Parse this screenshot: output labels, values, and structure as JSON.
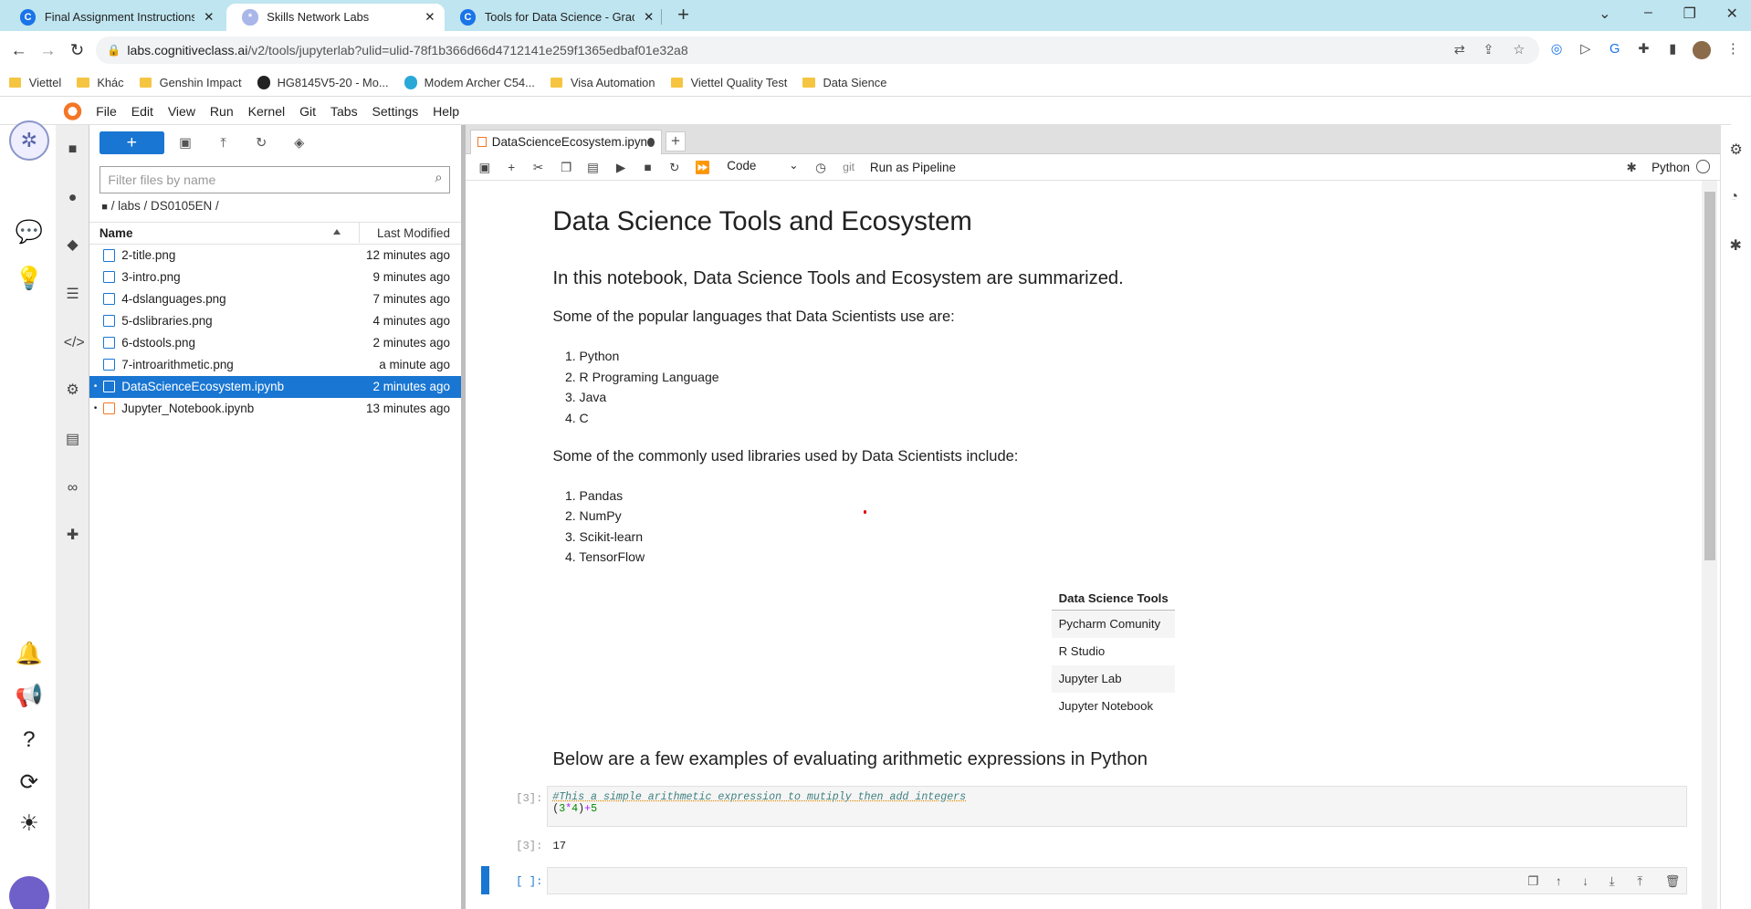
{
  "browser": {
    "tabs": [
      {
        "title": "Final Assignment Instructions: Cr",
        "favicon": "C",
        "favicon_color": "#1a73e8",
        "active": false
      },
      {
        "title": "Skills Network Labs",
        "favicon": "*",
        "favicon_color": "#a9b6e8",
        "active": true
      },
      {
        "title": "Tools for Data Science - Grades |",
        "favicon": "C",
        "favicon_color": "#1a73e8",
        "active": false
      }
    ],
    "new_tab": "+",
    "url_host": "labs.cognitiveclass.ai",
    "url_path": "/v2/tools/jupyterlab?ulid=ulid-78f1b366d66d4712141e259f1365edbaf01e32a8",
    "bookmarks": [
      "Viettel",
      "Khác",
      "Genshin Impact",
      "HG8145V5-20 - Mo...",
      "Modem Archer C54...",
      "Visa Automation",
      "Viettel Quality Test",
      "Data Sience"
    ]
  },
  "menu": [
    "File",
    "Edit",
    "View",
    "Run",
    "Kernel",
    "Git",
    "Tabs",
    "Settings",
    "Help"
  ],
  "file_browser": {
    "new_label": "+",
    "filter_placeholder": "Filter files by name",
    "breadcrumb": "/ labs / DS0105EN /",
    "col_name": "Name",
    "col_modified": "Last Modified",
    "files": [
      {
        "name": "2-title.png",
        "modified": "12 minutes ago",
        "kind": "image",
        "running": false,
        "selected": false
      },
      {
        "name": "3-intro.png",
        "modified": "9 minutes ago",
        "kind": "image",
        "running": false,
        "selected": false
      },
      {
        "name": "4-dslanguages.png",
        "modified": "7 minutes ago",
        "kind": "image",
        "running": false,
        "selected": false
      },
      {
        "name": "5-dslibraries.png",
        "modified": "4 minutes ago",
        "kind": "image",
        "running": false,
        "selected": false
      },
      {
        "name": "6-dstools.png",
        "modified": "2 minutes ago",
        "kind": "image",
        "running": false,
        "selected": false
      },
      {
        "name": "7-introarithmetic.png",
        "modified": "a minute ago",
        "kind": "image",
        "running": false,
        "selected": false
      },
      {
        "name": "DataScienceEcosystem.ipynb",
        "modified": "2 minutes ago",
        "kind": "notebook",
        "running": true,
        "selected": true
      },
      {
        "name": "Jupyter_Notebook.ipynb",
        "modified": "13 minutes ago",
        "kind": "notebook",
        "running": true,
        "selected": false
      }
    ]
  },
  "notebook": {
    "tab_title": "DataScienceEcosystem.ipyn",
    "cell_type": "Code",
    "git_label": "git",
    "run_pipeline": "Run as Pipeline",
    "kernel": "Python",
    "h1": "Data Science Tools and Ecosystem",
    "h2": "In this notebook, Data Science Tools and Ecosystem are summarized.",
    "languages_intro": "Some of the popular languages that Data Scientists use are:",
    "languages": [
      "1. Python",
      "2. R Programing Language",
      "3. Java",
      "4. C"
    ],
    "libraries_intro": "Some of the commonly used libraries used by Data Scientists include:",
    "libraries": [
      "1. Pandas",
      "2. NumPy",
      "3. Scikit-learn",
      "4. TensorFlow"
    ],
    "tools_header": "Data Science Tools",
    "tools": [
      "Pycharm Comunity",
      "R Studio",
      "Jupyter Lab",
      "Jupyter Notebook"
    ],
    "arith_heading": "Below are a few examples of evaluating arithmetic expressions in Python",
    "code_prompt": "[3]:",
    "code_comment": "#This a simple arithmetic expression to mutiply then add integers",
    "code_line2_a": "(",
    "code_line2_b": "3",
    "code_line2_c": "*",
    "code_line2_d": "4",
    "code_line2_e": ")",
    "code_line2_f": "+",
    "code_line2_g": "5",
    "out_prompt": "[3]:",
    "output": "17",
    "empty_prompt": "[ ]:"
  },
  "colors": {
    "accent": "#1976d2",
    "tab_bg": "#bfe5f0",
    "notebook_icon": "#f37726"
  }
}
